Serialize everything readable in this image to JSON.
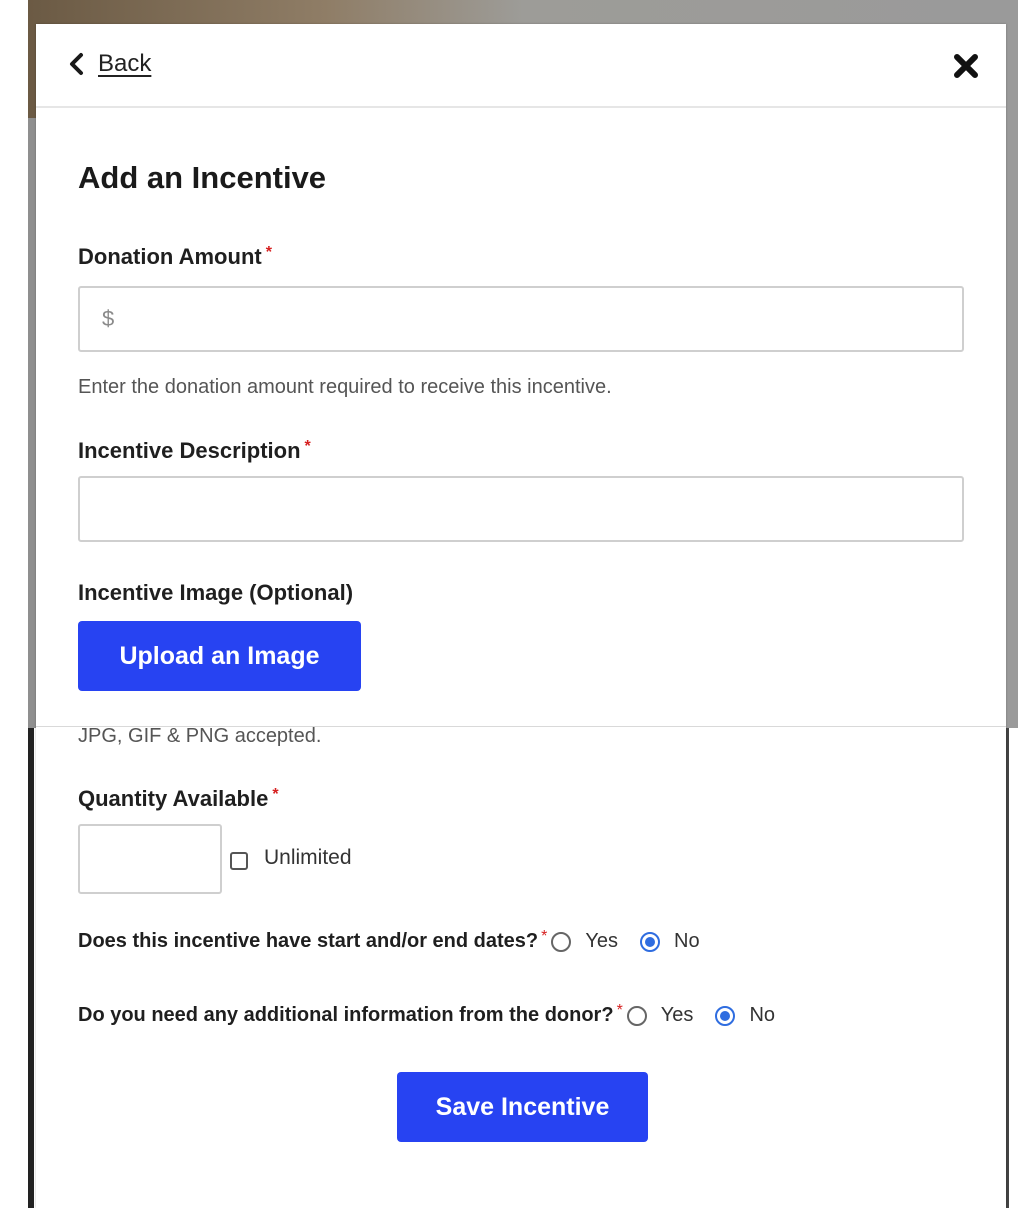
{
  "header": {
    "back_label": "Back"
  },
  "form": {
    "title": "Add an Incentive",
    "donation": {
      "label": "Donation Amount",
      "required_mark": "*",
      "placeholder": "$",
      "value": "",
      "help": "Enter the donation amount required to receive this incentive."
    },
    "description": {
      "label": "Incentive Description",
      "required_mark": "*",
      "value": ""
    },
    "image": {
      "label": "Incentive Image (Optional)",
      "upload_label": "Upload an Image",
      "help": "JPG, GIF & PNG accepted."
    },
    "quantity": {
      "label": "Quantity Available",
      "required_mark": "*",
      "value": "",
      "unlimited_label": "Unlimited",
      "unlimited_checked": false
    },
    "dates_question": {
      "text": "Does this incentive have start and/or end dates?",
      "required_mark": "*",
      "yes_label": "Yes",
      "no_label": "No",
      "selected": "No"
    },
    "info_question": {
      "text": "Do you need any additional information from the donor?",
      "required_mark": "*",
      "yes_label": "Yes",
      "no_label": "No",
      "selected": "No"
    },
    "save_label": "Save Incentive"
  },
  "colors": {
    "primary_button": "#2743f2",
    "required": "#d62020",
    "radio_selected": "#2f6de0"
  },
  "icons": {
    "back": "chevron-left-icon",
    "close": "close-icon"
  }
}
